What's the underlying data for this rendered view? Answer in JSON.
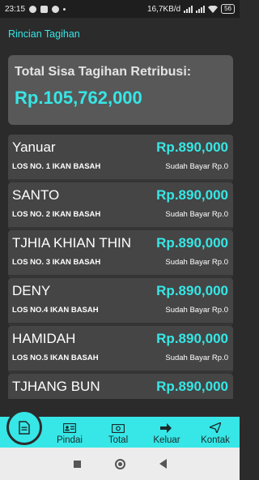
{
  "status_bar": {
    "time": "23:15",
    "network_speed": "16,7KB/d",
    "battery": "56"
  },
  "app_bar": {
    "title": "Rincian Tagihan"
  },
  "summary": {
    "label": "Total Sisa Tagihan Retribusi:",
    "amount": "Rp.105,762,000"
  },
  "items": [
    {
      "name": "Yanuar",
      "amount": "Rp.890,000",
      "los": "LOS NO. 1 IKAN BASAH",
      "status": "Sudah Bayar Rp.0"
    },
    {
      "name": "SANTO",
      "amount": "Rp.890,000",
      "los": "LOS NO. 2 IKAN BASAH",
      "status": "Sudah Bayar Rp.0"
    },
    {
      "name": "TJHIA KHIAN THIN",
      "amount": "Rp.890,000",
      "los": "LOS NO. 3 IKAN BASAH",
      "status": "Sudah Bayar Rp.0"
    },
    {
      "name": "DENY",
      "amount": "Rp.890,000",
      "los": "LOS NO.4 IKAN BASAH",
      "status": "Sudah Bayar Rp.0"
    },
    {
      "name": "HAMIDAH",
      "amount": "Rp.890,000",
      "los": "LOS NO.5 IKAN BASAH",
      "status": "Sudah Bayar Rp.0"
    },
    {
      "name": "TJHANG BUN",
      "amount": "Rp.890,000",
      "los": "",
      "status": ""
    }
  ],
  "bottom_nav": {
    "items": [
      {
        "label": "Pindai",
        "icon": "id-card-icon"
      },
      {
        "label": "Total",
        "icon": "cash-icon"
      },
      {
        "label": "Keluar",
        "icon": "logout-icon"
      },
      {
        "label": "Kontak",
        "icon": "send-icon"
      }
    ],
    "fab_icon": "document-icon"
  },
  "colors": {
    "accent": "#37e6e6",
    "background": "#2b2b2b",
    "card": "#454545",
    "summary_card": "#585858"
  }
}
